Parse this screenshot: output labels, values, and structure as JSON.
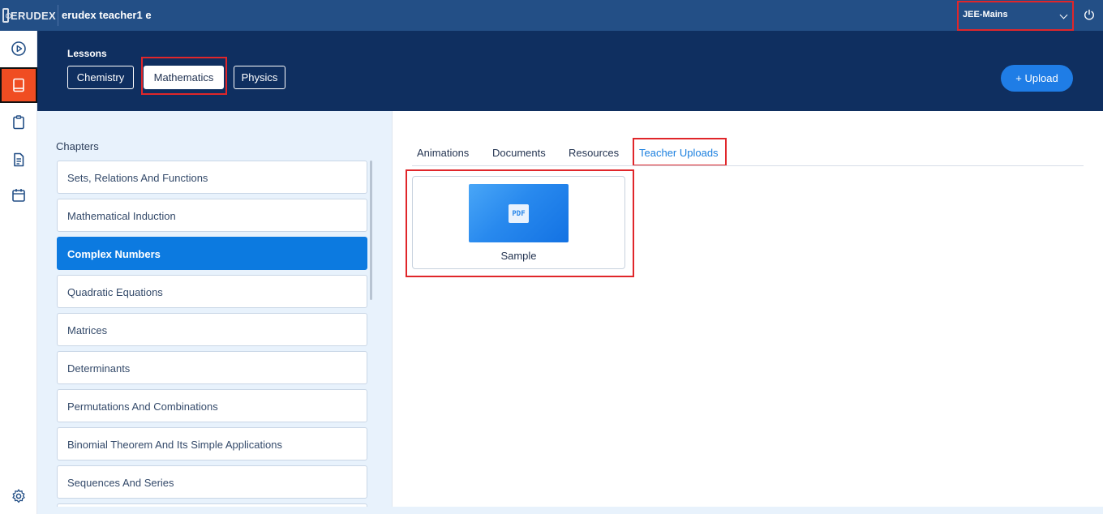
{
  "app": {
    "brand": "ERUDEX",
    "user_title": "erudex teacher1 e",
    "exam_selected": "JEE-Mains"
  },
  "header": {
    "lessons_label": "Lessons",
    "subjects": [
      "Chemistry",
      "Mathematics",
      "Physics"
    ],
    "selected_subject": "Mathematics",
    "upload_label": "+ Upload"
  },
  "sidebar": {
    "items": [
      {
        "icon": "play-circle-icon"
      },
      {
        "icon": "book-icon",
        "active": true
      },
      {
        "icon": "clipboard-icon"
      },
      {
        "icon": "document-icon"
      },
      {
        "icon": "calendar-icon"
      },
      {
        "icon": "gear-icon"
      }
    ]
  },
  "chapters": {
    "title": "Chapters",
    "items": [
      "Sets, Relations And Functions",
      "Mathematical Induction",
      "Complex Numbers",
      "Quadratic Equations",
      "Matrices",
      "Determinants",
      "Permutations And Combinations",
      "Binomial Theorem And Its Simple Applications",
      "Sequences And Series"
    ],
    "selected": "Complex Numbers"
  },
  "content": {
    "tabs": [
      "Animations",
      "Documents",
      "Resources",
      "Teacher Uploads"
    ],
    "active_tab": "Teacher Uploads",
    "files": [
      {
        "name": "Sample",
        "type_badge": "PDF"
      }
    ]
  },
  "colors": {
    "topbar": "#234f86",
    "band": "#0f2f60",
    "accent": "#1f7de6",
    "active_rail": "#f04d22",
    "highlight": "#e0262a"
  }
}
